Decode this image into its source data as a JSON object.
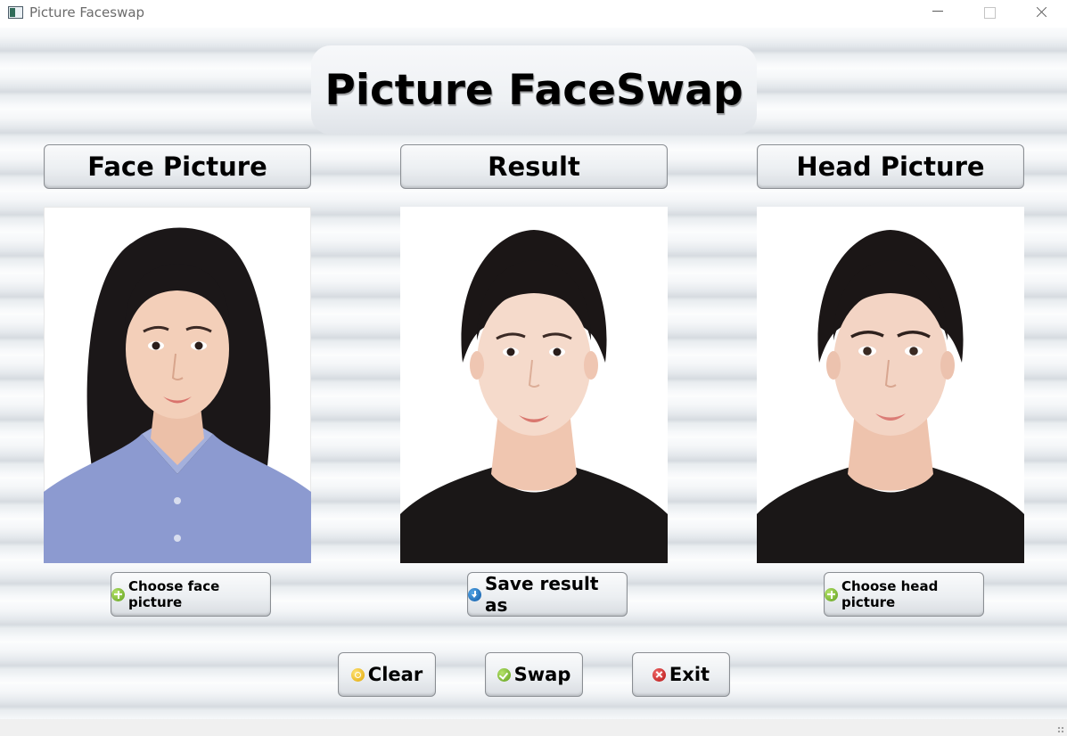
{
  "window": {
    "title": "Picture Faceswap",
    "icon": "app-window-icon",
    "controls": [
      "minimize-icon",
      "maximize-icon",
      "close-icon"
    ]
  },
  "headline": "Picture FaceSwap",
  "columns": {
    "face": {
      "header": "Face Picture",
      "button_label": "Choose face picture",
      "button_icon": "add-icon"
    },
    "result": {
      "header": "Result",
      "button_label": "Save result as",
      "button_icon": "download-icon"
    },
    "head": {
      "header": "Head Picture",
      "button_label": "Choose head picture",
      "button_icon": "add-icon"
    }
  },
  "bottom_buttons": {
    "clear": {
      "label": "Clear",
      "icon": "clear-icon"
    },
    "swap": {
      "label": "Swap",
      "icon": "check-icon"
    },
    "exit": {
      "label": "Exit",
      "icon": "exit-icon"
    }
  },
  "colors": {
    "accent_green": "#6aaa22",
    "accent_blue": "#1565b0",
    "accent_yellow": "#e8b100",
    "accent_red": "#c01818"
  }
}
